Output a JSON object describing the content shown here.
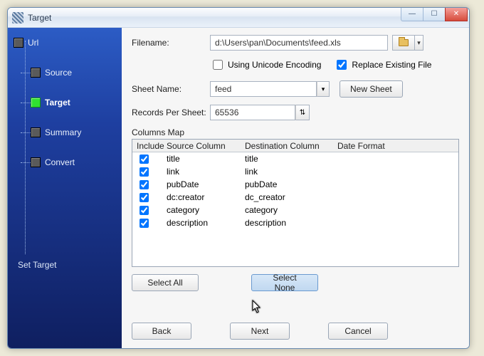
{
  "window": {
    "title": "Target"
  },
  "winbuttons": {
    "min": "—",
    "max": "☐",
    "close": "✕"
  },
  "sidebar": {
    "items": [
      {
        "label": "Url",
        "active": false
      },
      {
        "label": "Source",
        "active": false
      },
      {
        "label": "Target",
        "active": true
      },
      {
        "label": "Summary",
        "active": false
      },
      {
        "label": "Convert",
        "active": false
      }
    ],
    "footer": "Set Target"
  },
  "form": {
    "filename_label": "Filename:",
    "filename_value": "d:\\Users\\pan\\Documents\\feed.xls",
    "unicode_label": "Using Unicode Encoding",
    "unicode_checked": false,
    "replace_label": "Replace Existing File",
    "replace_checked": true,
    "sheetname_label": "Sheet Name:",
    "sheetname_value": "feed",
    "newsheet_label": "New Sheet",
    "records_label": "Records Per Sheet:",
    "records_value": "65536"
  },
  "columns_map": {
    "group_label": "Columns Map",
    "headers": {
      "include": "Include",
      "source": "Source Column",
      "destination": "Destination Column",
      "date_format": "Date Format"
    },
    "rows": [
      {
        "include": true,
        "source": "title",
        "destination": "title",
        "date_format": ""
      },
      {
        "include": true,
        "source": "link",
        "destination": "link",
        "date_format": ""
      },
      {
        "include": true,
        "source": "pubDate",
        "destination": "pubDate",
        "date_format": ""
      },
      {
        "include": true,
        "source": "dc:creator",
        "destination": "dc_creator",
        "date_format": ""
      },
      {
        "include": true,
        "source": "category",
        "destination": "category",
        "date_format": ""
      },
      {
        "include": true,
        "source": "description",
        "destination": "description",
        "date_format": ""
      }
    ]
  },
  "buttons": {
    "select_all": "Select All",
    "select_none": "Select None",
    "back": "Back",
    "next": "Next",
    "cancel": "Cancel"
  }
}
